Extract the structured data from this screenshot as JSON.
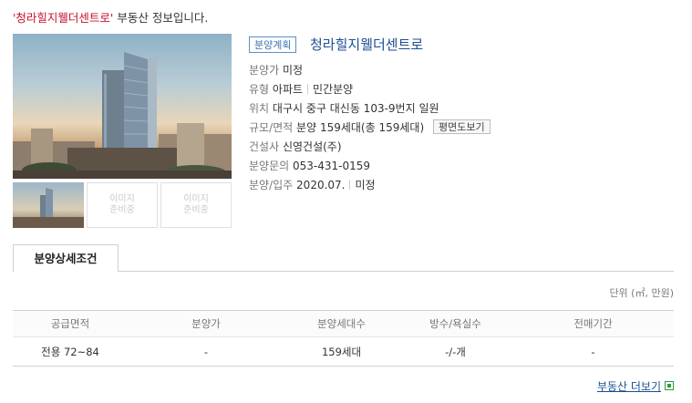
{
  "headline": {
    "highlight": "'청라힐지웰더센트로'",
    "rest": " 부동산 정보입니다."
  },
  "gallery": {
    "placeholder_line1": "이미지",
    "placeholder_line2": "준비중"
  },
  "property": {
    "type_badge": "분양계획",
    "name": "청라힐지웰더센트로",
    "price_label": "분양가",
    "price_value": "미정",
    "kind_label": "유형",
    "kind_value": "아파트",
    "supply_value": "민간분양",
    "location_label": "위치",
    "location_value": "대구시 중구 대신동 103-9번지 일원",
    "scale_label": "규모/면적",
    "scale_value": "분양 159세대(총 159세대)",
    "floorplan_button": "평면도보기",
    "builder_label": "건설사",
    "builder_value": "신영건설(주)",
    "contact_label": "분양문의",
    "contact_value": "053-431-0159",
    "schedule_label": "분양/입주",
    "sale_date": "2020.07.",
    "movein_date": "미정"
  },
  "tabs": [
    {
      "label": "분양상세조건"
    }
  ],
  "unit_note": "단위 (㎡, 만원)",
  "table": {
    "headers": [
      "공급면적",
      "분양가",
      "분양세대수",
      "방수/욕실수",
      "전매기간"
    ],
    "rows": [
      [
        "전용 72~84",
        "-",
        "159세대",
        "-/-개",
        "-"
      ]
    ]
  },
  "more_link": "부동산 더보기",
  "colors": {
    "highlight_red": "#c8102e",
    "link_blue": "#1d4f91",
    "badge_blue": "#5b8fc7",
    "icon_green": "#2e9a3e"
  }
}
